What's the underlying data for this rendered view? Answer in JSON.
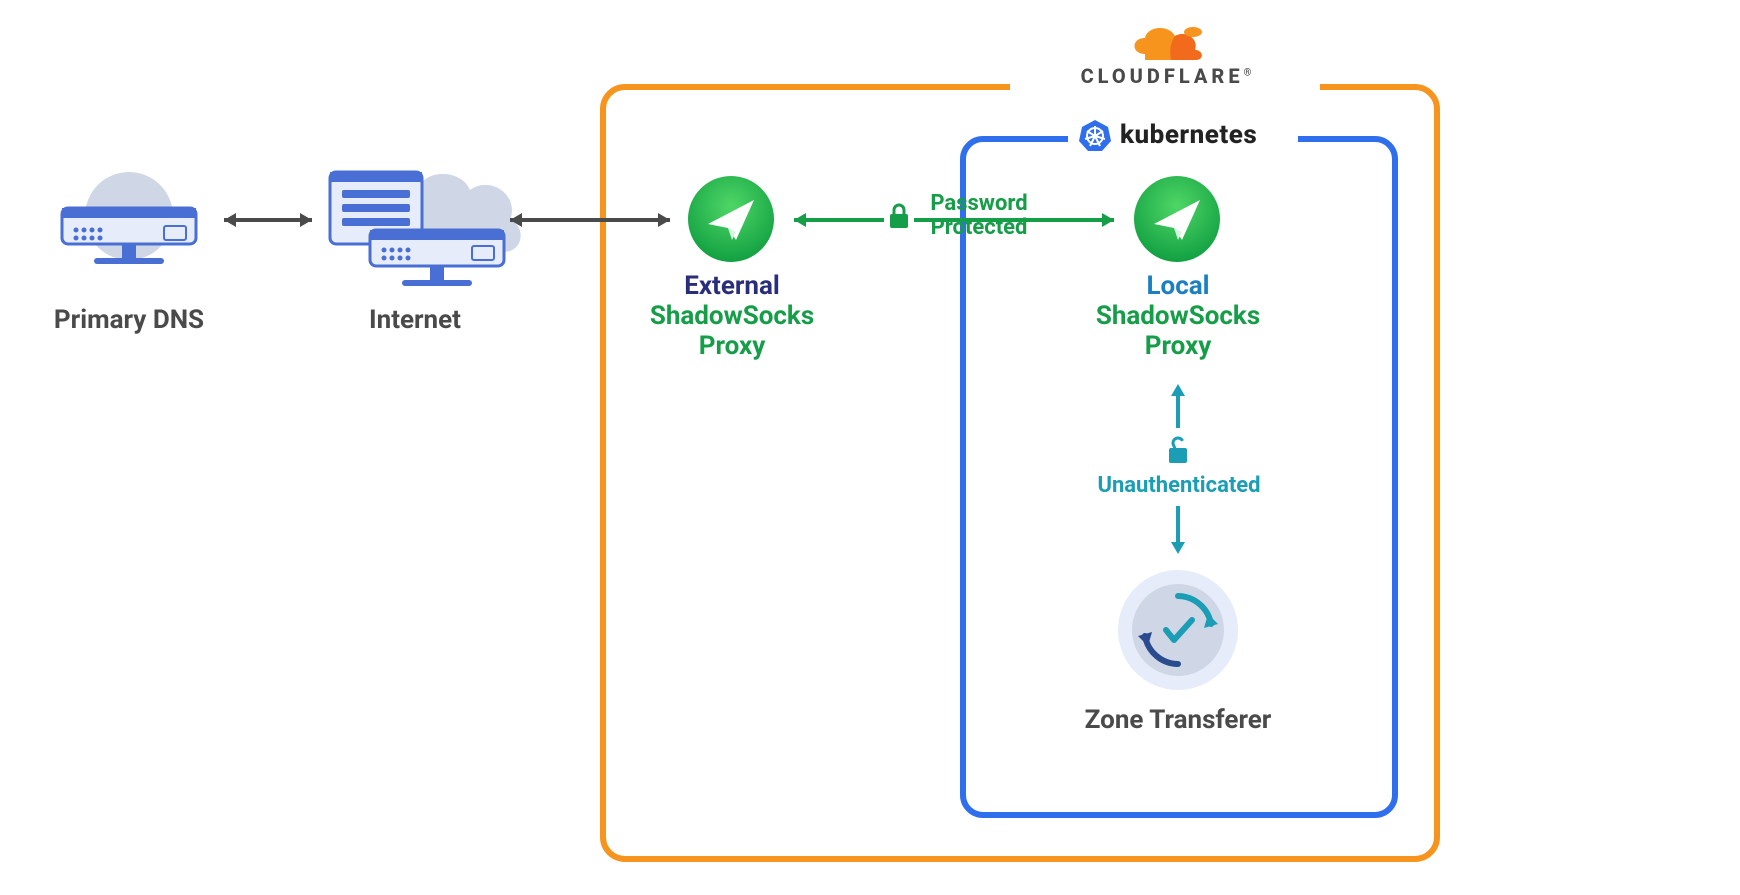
{
  "nodes": {
    "primary_dns": "Primary DNS",
    "internet": "Internet",
    "external_proxy_line1": "External",
    "external_proxy_line2": "ShadowSocks",
    "external_proxy_line3": "Proxy",
    "local_proxy_line1": "Local",
    "local_proxy_line2": "ShadowSocks",
    "local_proxy_line3": "Proxy",
    "zone_transferer": "Zone Transferer"
  },
  "connections": {
    "password_line1": "Password",
    "password_line2": "Protected",
    "unauth": "Unauthenticated"
  },
  "containers": {
    "cloudflare": "CLOUDFLARE",
    "kubernetes": "kubernetes"
  },
  "colors": {
    "orange": "#f7941d",
    "blue": "#2f6fed",
    "green": "#169d48",
    "teal": "#1b9eb5",
    "grey": "#4a4a4a",
    "navy": "#2a2e7a",
    "lightgrey": "#cfd6e6",
    "server_blue": "#4a6fd4",
    "server_light": "#e6ecf9",
    "cf_orange_dark": "#f26a1b"
  }
}
